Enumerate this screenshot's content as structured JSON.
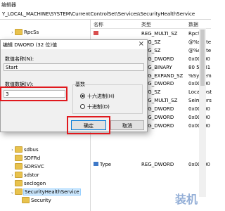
{
  "window": {
    "title": "编辑器",
    "address": "Y_LOCAL_MACHINE\\SYSTEM\\CurrentControlSet\\Services\\SecurityHealthService"
  },
  "tree": {
    "top_item": "RpcSs",
    "items": [
      "sdbus",
      "SDFRd",
      "SDRSVC",
      "sdstor",
      "seclogon",
      "SecurityHealthService",
      "Security"
    ]
  },
  "values_pane": {
    "columns": [
      "名称",
      "类型",
      "数据"
    ],
    "rows": [
      {
        "type": "REG_MULTI_SZ",
        "data": "RpcSs"
      },
      {
        "type": "REG_SZ",
        "data": "@%syste"
      },
      {
        "type": "REG_SZ",
        "data": "@%syste"
      },
      {
        "type": "REG_DWORD",
        "data": "0x00000"
      },
      {
        "type": "REG_BINARY",
        "data": "80 51 01"
      },
      {
        "type": "REG_EXPAND_SZ",
        "data": "%System"
      },
      {
        "type": "REG_DWORD",
        "data": "0x00000"
      },
      {
        "type": "REG_SZ",
        "data": "LocalSyst"
      },
      {
        "type": "REG_MULTI_SZ",
        "data": "SeImpers"
      },
      {
        "type": "REG_DWORD",
        "data": "0x00000"
      },
      {
        "type": "REG_DWORD",
        "data": "0x00000"
      },
      {
        "type": "REG_DWORD",
        "data": "0x00000"
      }
    ],
    "last_row": {
      "name": "Type",
      "type": "REG_DWORD",
      "data": "0x00000"
    }
  },
  "dialog": {
    "title": "编辑 DWORD (32 位)值",
    "close": "×",
    "name_label": "数值名称(N):",
    "name_value": "Start",
    "data_label": "数值数据(V):",
    "data_value": "3",
    "base_label": "基数",
    "hex_label": "十六进制(H)",
    "dec_label": "十进制(D)",
    "ok_label": "确定",
    "cancel_label": "取消"
  },
  "watermark": "装机",
  "colors": {
    "highlight": "#e0191e",
    "selection": "#cce8ff",
    "folder": "#e8c24d"
  }
}
